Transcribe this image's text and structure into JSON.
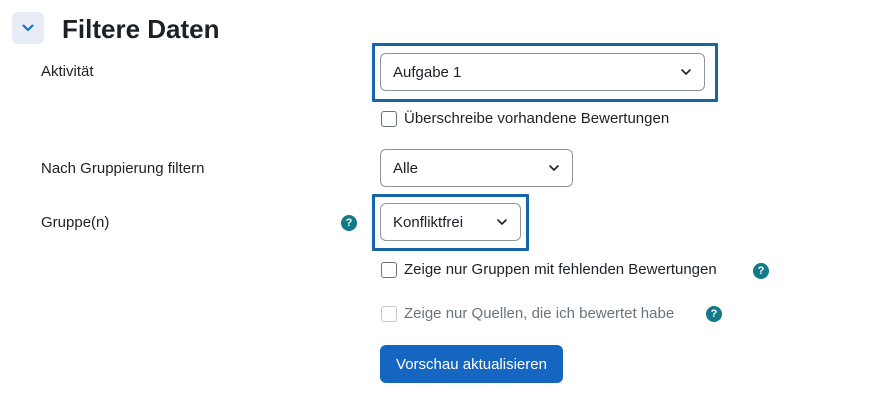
{
  "section": {
    "title": "Filtere Daten",
    "collapse_icon": "chevron-down-icon"
  },
  "activity": {
    "label": "Aktivität",
    "selected": "Aufgabe 1"
  },
  "overwrite": {
    "label": "Überschreibe vorhandene Bewertungen",
    "checked": false
  },
  "grouping": {
    "label": "Nach Gruppierung filtern",
    "selected": "Alle"
  },
  "groups": {
    "label": "Gruppe(n)",
    "selected": "Konfliktfrei",
    "help_icon": "question-circle-icon"
  },
  "missing_only": {
    "label": "Zeige nur Gruppen mit fehlenden Bewertungen",
    "checked": false,
    "help_icon": "question-circle-icon"
  },
  "graded_by_me": {
    "label": "Zeige nur Quellen, die ich bewertet habe",
    "checked": false,
    "disabled": true,
    "help_icon": "question-circle-icon"
  },
  "preview_button": {
    "label": "Vorschau aktualisieren"
  },
  "colors": {
    "primary": "#0f6cbf",
    "help": "#127a89",
    "highlight_border": "#1565a8"
  }
}
